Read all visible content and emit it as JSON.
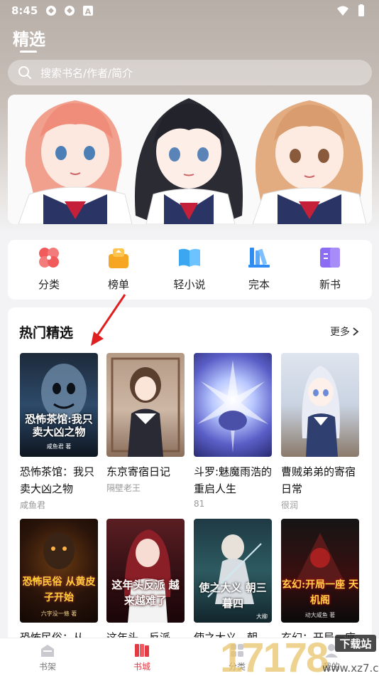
{
  "status_bar": {
    "time": "8:45"
  },
  "header": {
    "title": "精选"
  },
  "search": {
    "placeholder": "搜索书名/作者/简介"
  },
  "categories": [
    {
      "label": "分类",
      "icon": "grid-petal-icon",
      "color": "#f25b5b"
    },
    {
      "label": "榜单",
      "icon": "crown-ranking-icon",
      "color": "#f6a623"
    },
    {
      "label": "轻小说",
      "icon": "open-book-icon",
      "color": "#3aa7f0"
    },
    {
      "label": "完本",
      "icon": "books-shelf-icon",
      "color": "#2f8cf2"
    },
    {
      "label": "新书",
      "icon": "new-book-icon",
      "color": "#8b6cf2"
    }
  ],
  "hot": {
    "title": "热门精选",
    "more": "更多",
    "books": [
      {
        "title": "恐怖茶馆：我只卖大凶之物",
        "author": "咸鱼君",
        "cover_text": "恐怖茶馆:我只卖大凶之物",
        "cover_author": "咸鱼君 著"
      },
      {
        "title": "东京寄宿日记",
        "author": "隔壁老王"
      },
      {
        "title": "斗罗:魅魔雨浩的重启人生",
        "author": "81"
      },
      {
        "title": "曹贼弟弟的寄宿日常",
        "author": "很润"
      },
      {
        "title": "恐怖民俗：从黄...",
        "author": "",
        "cover_text": "恐怖民俗 从黄皮子开始",
        "cover_author": "六字没一條 著"
      },
      {
        "title": "这年头，反派越...",
        "author": "",
        "cover_text": "这年头反派 越来越难了"
      },
      {
        "title": "使之大义，朝三...",
        "author": "",
        "cover_text": "使之大义 朝三暮四",
        "cover_author": "大柳"
      },
      {
        "title": "玄幻：开局一座...",
        "author": "",
        "cover_text": "玄幻:开局一座 天机阁",
        "cover_author": "动大咸鱼 著"
      }
    ]
  },
  "bottom_nav": [
    {
      "label": "书架"
    },
    {
      "label": "书城"
    },
    {
      "label": "分类"
    },
    {
      "label": "我的"
    }
  ],
  "watermark": {
    "number": "17178",
    "site": "www.xz7.com",
    "badge": "下载站"
  }
}
